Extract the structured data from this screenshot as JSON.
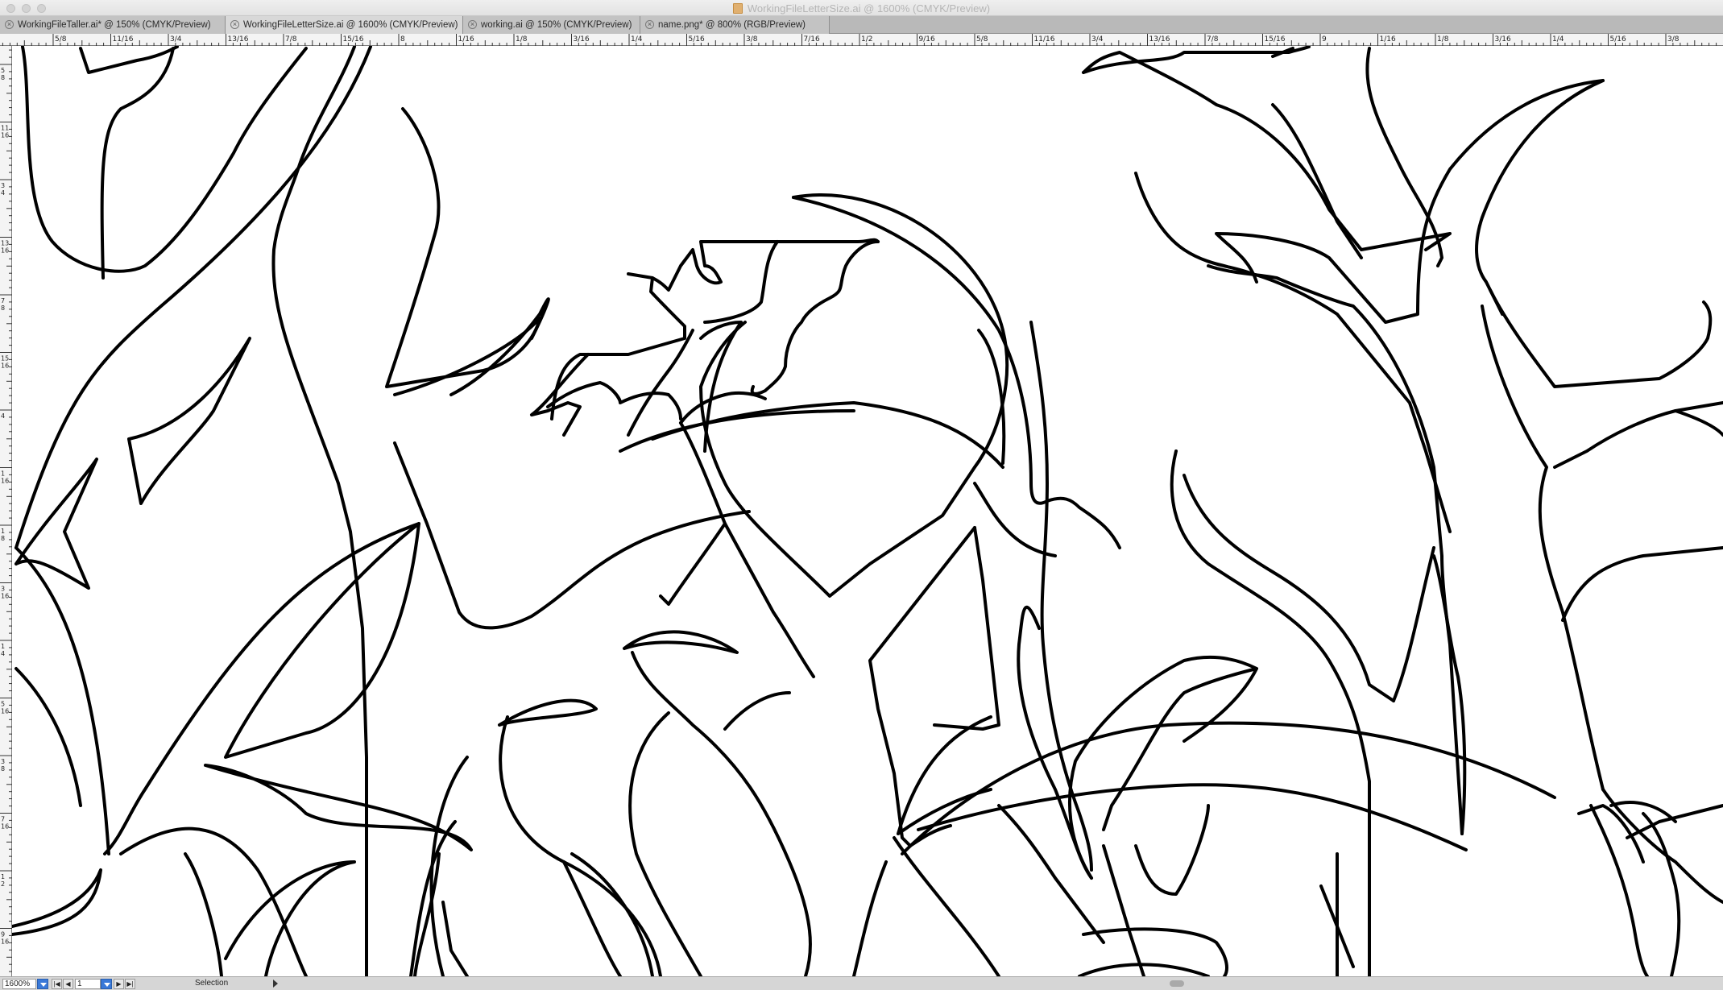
{
  "window": {
    "title": "WorkingFileLetterSize.ai @ 1600% (CMYK/Preview)"
  },
  "tabs": [
    {
      "label": "WorkingFileTaller.ai* @ 150% (CMYK/Preview)",
      "active": false
    },
    {
      "label": "WorkingFileLetterSize.ai @ 1600% (CMYK/Preview)",
      "active": true
    },
    {
      "label": "working.ai @ 150% (CMYK/Preview)",
      "active": false
    },
    {
      "label": "name.png* @ 800% (RGB/Preview)",
      "active": false
    }
  ],
  "ruler_top": [
    "5/8",
    "11/16",
    "3/4",
    "13/16",
    "7/8",
    "15/16",
    "8",
    "1/16",
    "1/8",
    "3/16",
    "1/4",
    "5/16",
    "3/8",
    "7/16",
    "1/2",
    "9/16",
    "5/8",
    "11/16",
    "3/4",
    "13/16",
    "7/8",
    "15/16",
    "9",
    "1/16",
    "1/8",
    "3/16",
    "1/4",
    "5/16",
    "3/8"
  ],
  "ruler_left": [
    "5/8",
    "11/16",
    "3/4",
    "13/16",
    "7/8",
    "15/16",
    "4",
    "1/16",
    "1/8",
    "3/16",
    "1/4",
    "5/16",
    "3/8",
    "7/16",
    "1/2",
    "9/16"
  ],
  "statusbar": {
    "zoom": "1600%",
    "artboard": "1",
    "tool": "Selection"
  },
  "colors": {
    "stroke": "#000000",
    "canvas": "#ffffff",
    "chrome": "#d6d6d6",
    "accent": "#3a79d8"
  },
  "icons": {
    "close": "close-icon",
    "document": "document-icon",
    "dropdown": "chevron-down-icon"
  }
}
